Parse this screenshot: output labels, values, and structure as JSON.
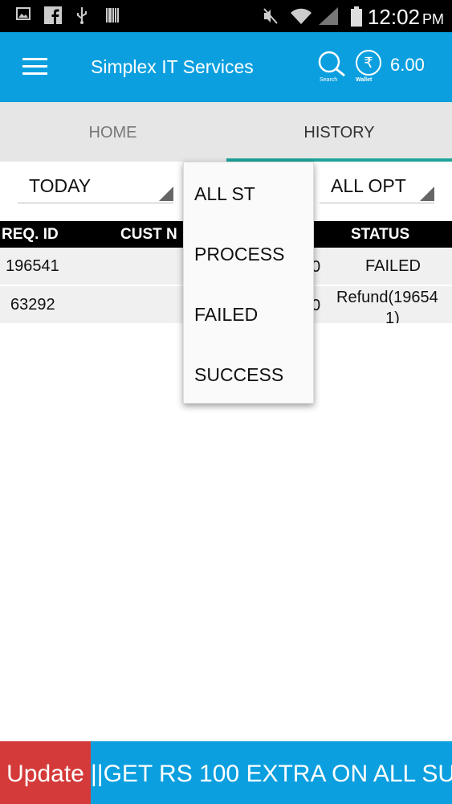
{
  "status_bar": {
    "time": "12:02",
    "ampm": "PM",
    "icons": [
      "image-icon",
      "facebook-icon",
      "usb-icon",
      "barcode-icon",
      "mute-icon",
      "wifi-icon",
      "signal-icon",
      "battery-icon"
    ]
  },
  "app_bar": {
    "title": "Simplex IT Services",
    "search_caption": "Search",
    "wallet_symbol": "₹",
    "wallet_caption": "Wallet",
    "wallet_balance": "6.00"
  },
  "tabs": [
    {
      "label": "HOME",
      "active": false
    },
    {
      "label": "HISTORY",
      "active": true
    }
  ],
  "filters": {
    "date_value": "TODAY",
    "operator_value": "ALL OPT"
  },
  "status_dropdown": {
    "options": [
      "ALL ST",
      "PROCESS",
      "FAILED",
      "SUCCESS"
    ]
  },
  "table": {
    "headers": [
      "REQ. ID",
      "CUST N",
      "STATUS"
    ],
    "rows": [
      {
        "req_id": "196541",
        "amount_partial": "0",
        "status": "FAILED"
      },
      {
        "req_id": "63292",
        "amount_partial": "0",
        "status_line1": "Refund(19654",
        "status_line2": "1)"
      }
    ]
  },
  "ticker": {
    "label": "Update",
    "text": "||GET RS 100 EXTRA  ON ALL SU"
  },
  "colors": {
    "primary": "#0b9fdf",
    "tab_indicator": "#1ea39a",
    "ticker_label": "#d53a3a"
  }
}
